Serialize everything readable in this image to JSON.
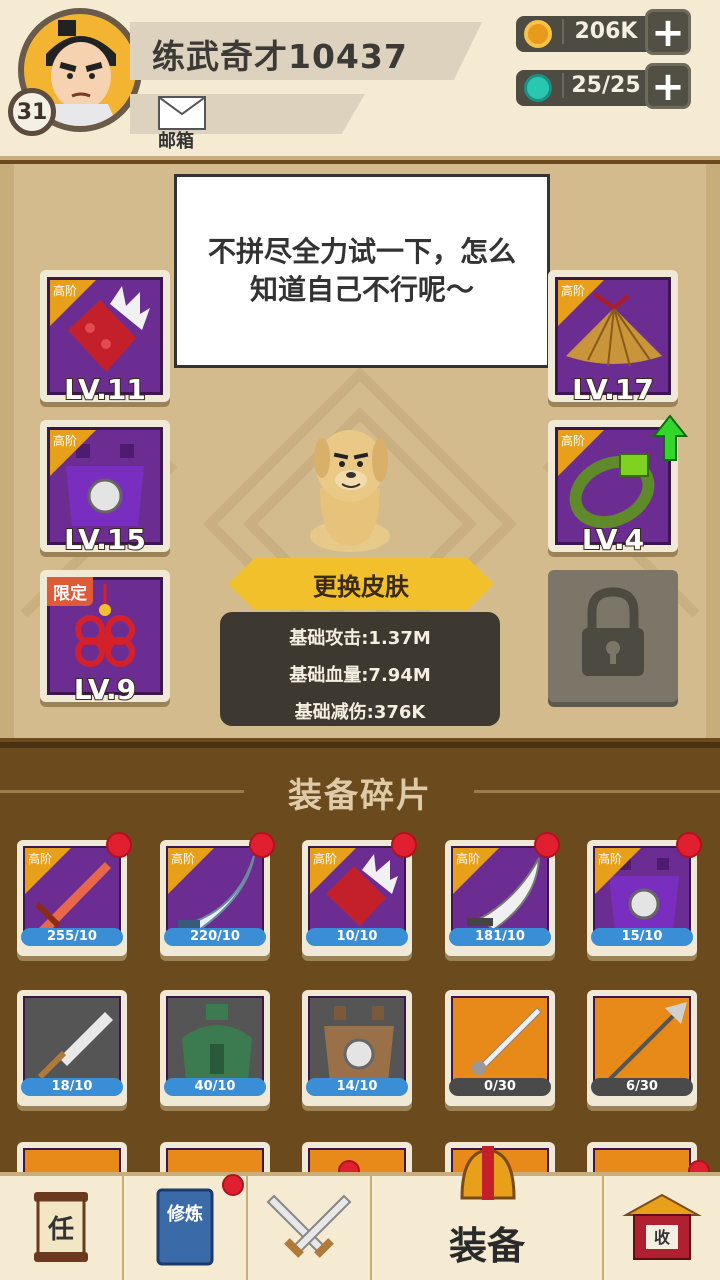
{
  "header": {
    "player_name": "练武奇才10437",
    "level": "31",
    "mail_label": "邮箱",
    "coins": "206K",
    "energy": "25/25",
    "plus_glyph": "+"
  },
  "speech": "不拼尽全力试一下，怎么知道自己不行呢～",
  "equipment_slots": [
    {
      "tier": "高阶",
      "level": "LV.11",
      "icon": "red-gauntlet-icon"
    },
    {
      "tier": "高阶",
      "level": "LV.17",
      "icon": "straw-hat-icon"
    },
    {
      "tier": "高阶",
      "level": "LV.15",
      "icon": "purple-armor-icon"
    },
    {
      "tier": "高阶",
      "level": "LV.4",
      "icon": "green-bracelet-icon"
    },
    {
      "tag": "限定",
      "level": "LV.9",
      "icon": "chinese-knot-icon"
    }
  ],
  "skin_button": "更换皮肤",
  "stats": {
    "attack": "基础攻击:1.37M",
    "hp": "基础血量:7.94M",
    "defense": "基础减伤:376K"
  },
  "fragments": {
    "title": "装备碎片",
    "row1": [
      {
        "tier": "高阶",
        "count": "255/10",
        "icon": "flame-sword-icon"
      },
      {
        "tier": "高阶",
        "count": "220/10",
        "icon": "curved-blade-icon"
      },
      {
        "tier": "高阶",
        "count": "10/10",
        "icon": "red-gauntlet-icon"
      },
      {
        "tier": "高阶",
        "count": "181/10",
        "icon": "broadsword-icon"
      },
      {
        "tier": "高阶",
        "count": "15/10",
        "icon": "purple-armor-icon"
      }
    ],
    "row2": [
      {
        "count": "18/10",
        "icon": "iron-sword-icon"
      },
      {
        "count": "40/10",
        "icon": "green-armor-icon"
      },
      {
        "count": "14/10",
        "icon": "leather-armor-icon"
      },
      {
        "count": "0/30",
        "icon": "silver-sword-icon"
      },
      {
        "count": "6/30",
        "icon": "spear-icon"
      }
    ]
  },
  "nav": {
    "task_glyph": "任",
    "train_glyph": "修炼",
    "equip_label": "装备",
    "collect_glyph": "收"
  },
  "colors": {
    "accent": "#f2c02a",
    "epic": "#6c2d92",
    "common": "#555555",
    "legendary": "#e88a1a",
    "badge": "#e02030",
    "count_blue": "#3a8ed6"
  }
}
